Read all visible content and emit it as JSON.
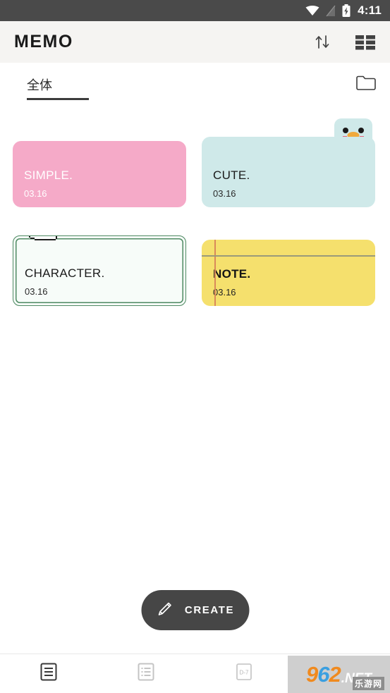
{
  "status_bar": {
    "time": "4:11",
    "icons": [
      "wifi-icon",
      "no-sim-icon",
      "battery-charging-icon"
    ]
  },
  "app_bar": {
    "title": "MEMO",
    "actions": [
      {
        "name": "sort-icon",
        "label": "Sort"
      },
      {
        "name": "grid-view-icon",
        "label": "View"
      }
    ]
  },
  "tabs": {
    "items": [
      {
        "label": "全体",
        "selected": true
      }
    ],
    "folder_action": "folder-icon"
  },
  "memos": [
    {
      "title": "SIMPLE.",
      "date": "03.16",
      "style": "simple",
      "color": "#f5aac8",
      "decoration": "none"
    },
    {
      "title": "CUTE.",
      "date": "03.16",
      "style": "cute",
      "color": "#cfe9e9",
      "decoration": "bird-face"
    },
    {
      "title": "CHARACTER.",
      "date": "03.16",
      "style": "character",
      "color": "#f7fcf9",
      "border_color": "#4f8a63",
      "decoration": "pixel-rabbit"
    },
    {
      "title": "NOTE.",
      "date": "03.16",
      "style": "note",
      "color": "#f5e06d",
      "decoration": "ruled-lines"
    }
  ],
  "create_button": {
    "label": "CREATE",
    "icon": "pencil-icon"
  },
  "bottom_nav": [
    {
      "name": "memo-tab",
      "icon": "memo-icon",
      "active": true
    },
    {
      "name": "list-tab",
      "icon": "list-icon",
      "active": false
    },
    {
      "name": "dday-tab",
      "icon": "dday-icon",
      "label": "D-7",
      "active": false
    }
  ],
  "watermark": {
    "digits": "962",
    "suffix": ".NET",
    "chinese": "乐游网"
  }
}
